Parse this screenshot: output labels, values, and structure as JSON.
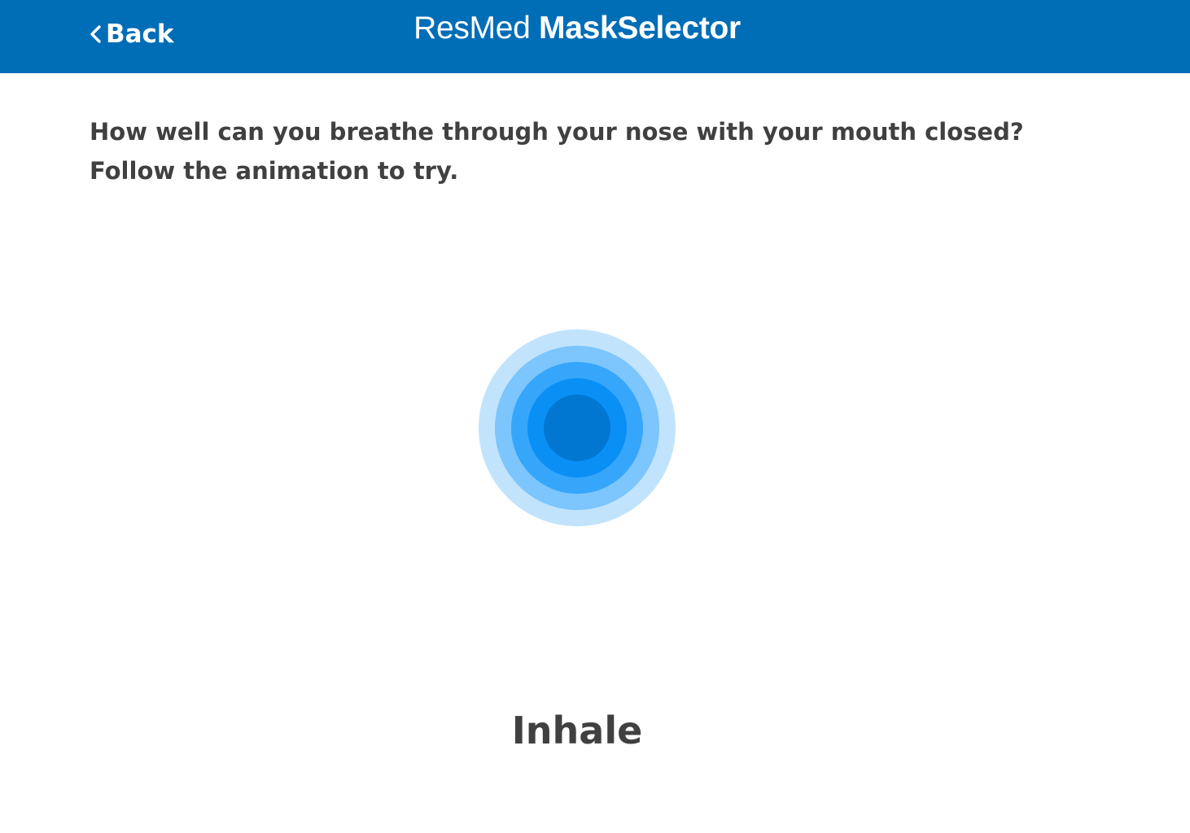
{
  "header": {
    "back_label": "Back",
    "brand_light": "ResMed ",
    "brand_bold": "MaskSelector",
    "background_color": "#006db7"
  },
  "main": {
    "question": "How well can you breathe through your nose with your mouth closed? Follow the animation to try.",
    "breathing_state": "Inhale"
  },
  "colors": {
    "ring_1": "#c2e3fc",
    "ring_2": "#7cc5fd",
    "ring_3": "#36a6fb",
    "ring_4": "#0a8ff5",
    "ring_5": "#0277d1",
    "text": "#404040"
  },
  "icons": {
    "back": "chevron-left-icon"
  }
}
